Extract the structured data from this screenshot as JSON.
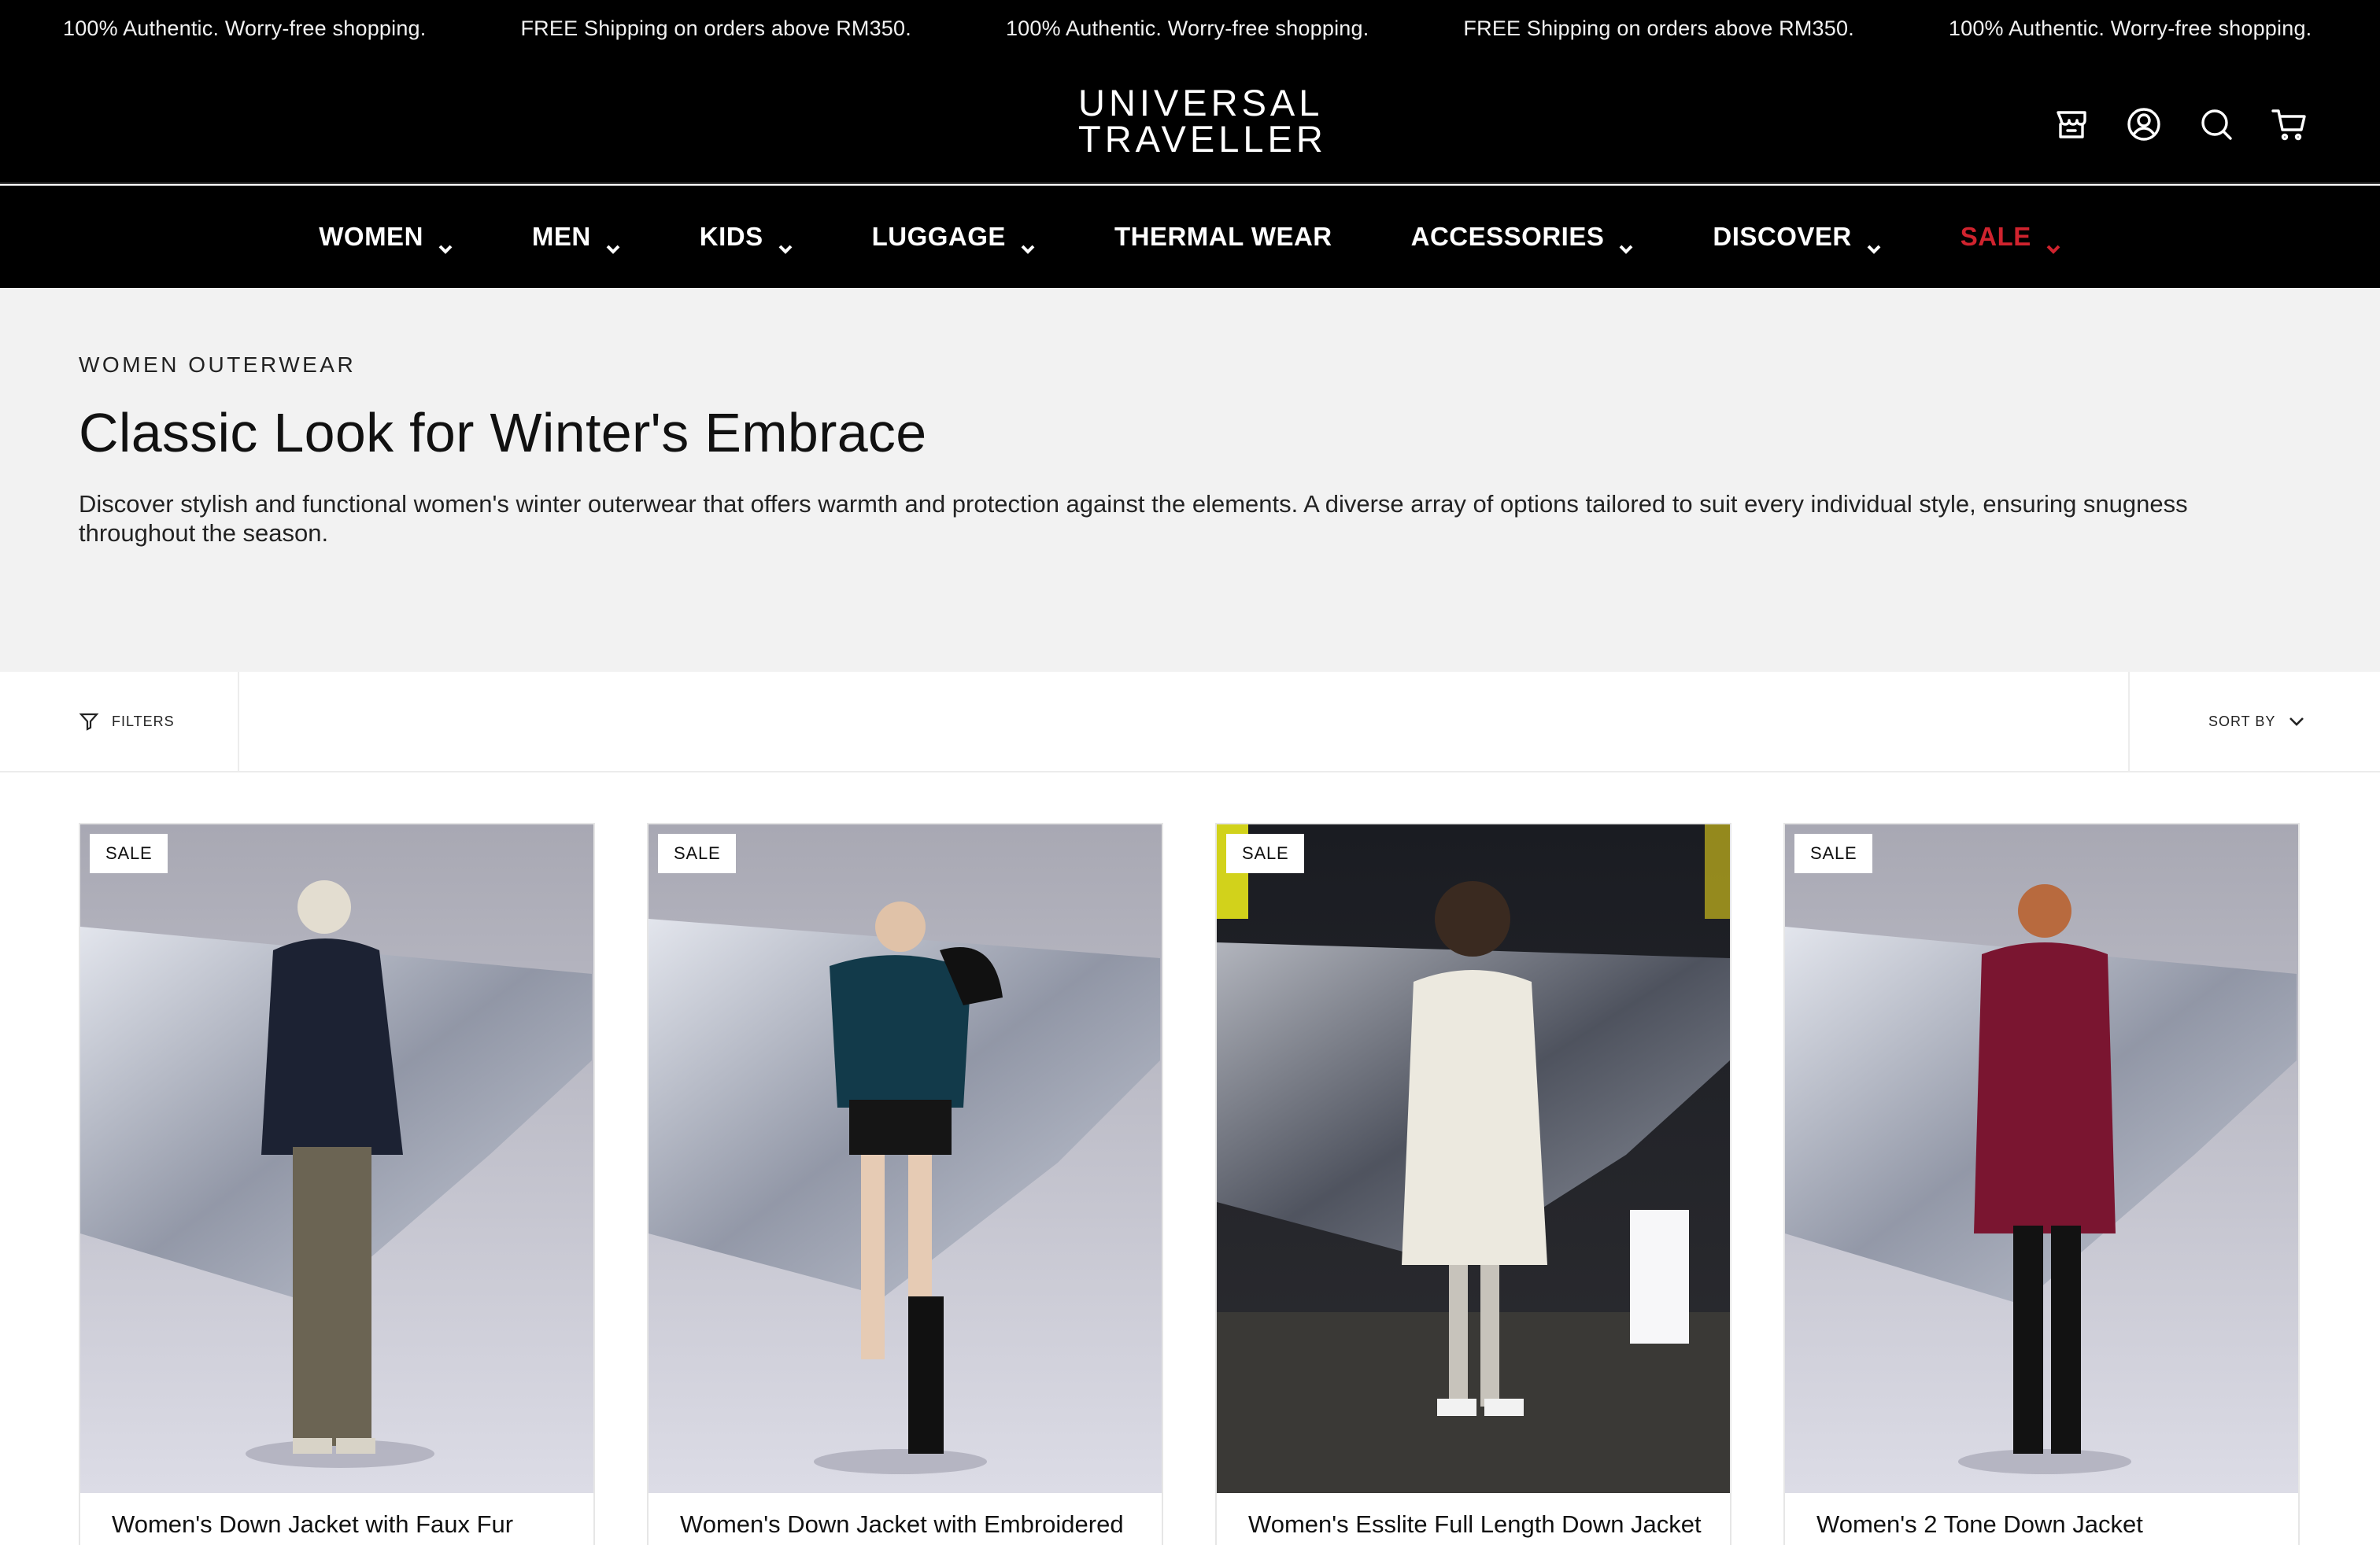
{
  "announcement": {
    "messages": [
      "100% Authentic. Worry-free shopping.",
      "FREE Shipping on orders above RM350.",
      "100% Authentic. Worry-free shopping.",
      "FREE Shipping on orders above RM350.",
      "100% Authentic. Worry-free shopping."
    ]
  },
  "header": {
    "logo_line1": "UNIVERSAL",
    "logo_line2": "TRAVELLER",
    "icons": [
      "store-icon",
      "account-icon",
      "search-icon",
      "cart-icon"
    ]
  },
  "nav": {
    "items": [
      {
        "label": "WOMEN",
        "has_dropdown": true
      },
      {
        "label": "MEN",
        "has_dropdown": true
      },
      {
        "label": "KIDS",
        "has_dropdown": true
      },
      {
        "label": "LUGGAGE",
        "has_dropdown": true
      },
      {
        "label": "THERMAL WEAR",
        "has_dropdown": false
      },
      {
        "label": "ACCESSORIES",
        "has_dropdown": true
      },
      {
        "label": "DISCOVER",
        "has_dropdown": true
      },
      {
        "label": "SALE",
        "has_dropdown": true
      }
    ],
    "sale_color": "#d0232e"
  },
  "hero": {
    "eyebrow": "WOMEN OUTERWEAR",
    "title": "Classic Look for Winter's Embrace",
    "description": "Discover stylish and functional women's winter outerwear that offers warmth and protection against the elements. A diverse array of options tailored to suit every individual style, ensuring snugness throughout the season."
  },
  "toolbar": {
    "filters_label": "FILTERS",
    "sort_label": "SORT BY"
  },
  "products": [
    {
      "badge": "SALE",
      "name": "Women's Down Jacket with Faux Fur",
      "jacket_color": "#1c2233"
    },
    {
      "badge": "SALE",
      "name": "Women's Down Jacket with Embroidered",
      "jacket_color": "#123a4a"
    },
    {
      "badge": "SALE",
      "name": "Women's Esslite Full Length Down Jacket",
      "jacket_color": "#ece9df"
    },
    {
      "badge": "SALE",
      "name": "Women's 2 Tone Down Jacket",
      "jacket_color": "#7a1530"
    }
  ]
}
